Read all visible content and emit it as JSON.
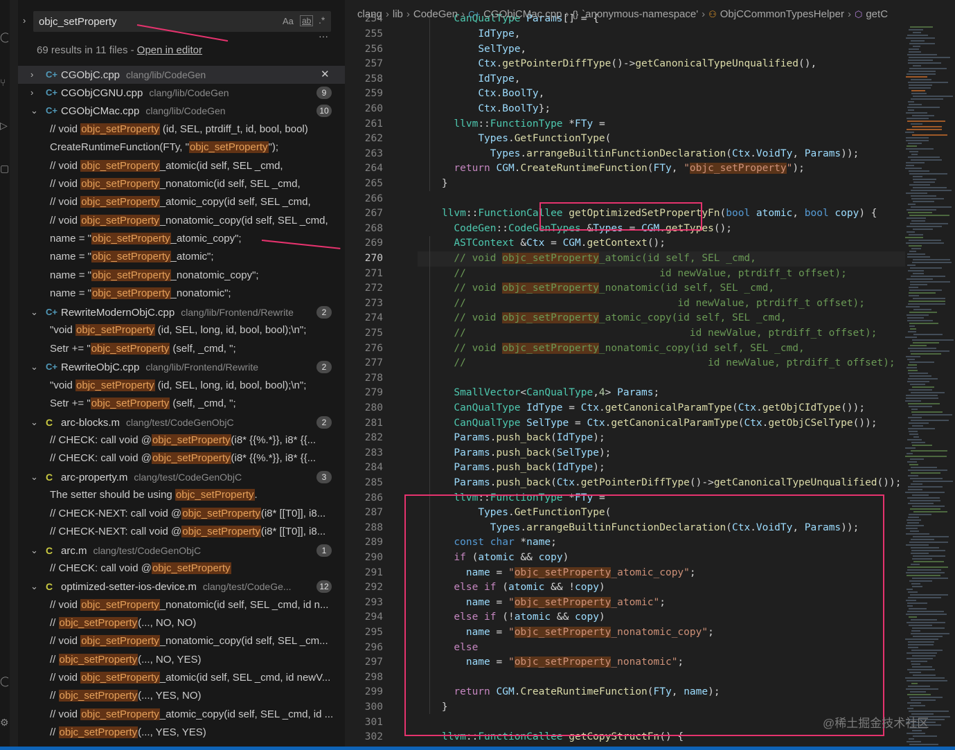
{
  "search": {
    "query": "objc_setProperty",
    "option_case": "Aa",
    "option_word": "ab",
    "option_regex": ".*",
    "more": "···",
    "summary": "69 results in 11 files - ",
    "open_in_editor": "Open in editor"
  },
  "results": [
    {
      "kind": "file",
      "icon": "C+",
      "lang": "cpp",
      "name": "CGObjC.cpp",
      "path": "clang/lib/CodeGen",
      "close": "✕",
      "selected": true,
      "collapsed": true
    },
    {
      "kind": "file",
      "icon": "C+",
      "lang": "cpp",
      "name": "CGObjCGNU.cpp",
      "path": "clang/lib/CodeGen",
      "badge": "9",
      "collapsed": true
    },
    {
      "kind": "file",
      "icon": "C+",
      "lang": "cpp",
      "name": "CGObjCMac.cpp",
      "path": "clang/lib/CodeGen",
      "badge": "10"
    },
    {
      "kind": "match",
      "pre": "// void ",
      "hl": "objc_setProperty",
      "post": " (id, SEL, ptrdiff_t, id, bool, bool)"
    },
    {
      "kind": "match",
      "pre": "CreateRuntimeFunction(FTy, \"",
      "hl": "objc_setProperty",
      "post": "\");"
    },
    {
      "kind": "match",
      "pre": "// void ",
      "hl": "objc_setProperty",
      "post": "_atomic(id self, SEL _cmd,"
    },
    {
      "kind": "match",
      "pre": "// void ",
      "hl": "objc_setProperty",
      "post": "_nonatomic(id self, SEL _cmd,"
    },
    {
      "kind": "match",
      "pre": "// void ",
      "hl": "objc_setProperty",
      "post": "_atomic_copy(id self, SEL _cmd,"
    },
    {
      "kind": "match",
      "pre": "// void ",
      "hl": "objc_setProperty",
      "post": "_nonatomic_copy(id self, SEL _cmd,"
    },
    {
      "kind": "match",
      "pre": "name = \"",
      "hl": "objc_setProperty",
      "post": "_atomic_copy\";"
    },
    {
      "kind": "match",
      "pre": "name = \"",
      "hl": "objc_setProperty",
      "post": "_atomic\";"
    },
    {
      "kind": "match",
      "pre": "name = \"",
      "hl": "objc_setProperty",
      "post": "_nonatomic_copy\";"
    },
    {
      "kind": "match",
      "pre": "name = \"",
      "hl": "objc_setProperty",
      "post": "_nonatomic\";"
    },
    {
      "kind": "file",
      "icon": "C+",
      "lang": "cpp",
      "name": "RewriteModernObjC.cpp",
      "path": "clang/lib/Frontend/Rewrite",
      "badge": "2"
    },
    {
      "kind": "match",
      "pre": "\"void ",
      "hl": "objc_setProperty",
      "post": " (id, SEL, long, id, bool, bool);\\n\";"
    },
    {
      "kind": "match",
      "pre": "Setr += \"",
      "hl": "objc_setProperty",
      "post": " (self, _cmd, \";"
    },
    {
      "kind": "file",
      "icon": "C+",
      "lang": "cpp",
      "name": "RewriteObjC.cpp",
      "path": "clang/lib/Frontend/Rewrite",
      "badge": "2"
    },
    {
      "kind": "match",
      "pre": "\"void ",
      "hl": "objc_setProperty",
      "post": " (id, SEL, long, id, bool, bool);\\n\";"
    },
    {
      "kind": "match",
      "pre": "Setr += \"",
      "hl": "objc_setProperty",
      "post": " (self, _cmd, \";"
    },
    {
      "kind": "file",
      "icon": "C",
      "lang": "c",
      "name": "arc-blocks.m",
      "path": "clang/test/CodeGenObjC",
      "badge": "2"
    },
    {
      "kind": "match",
      "pre": "// CHECK:    call void @",
      "hl": "objc_setProperty",
      "post": "(i8* {{%.*}}, i8* {{..."
    },
    {
      "kind": "match",
      "pre": "// CHECK:    call void @",
      "hl": "objc_setProperty",
      "post": "(i8* {{%.*}}, i8* {{..."
    },
    {
      "kind": "file",
      "icon": "C",
      "lang": "c",
      "name": "arc-property.m",
      "path": "clang/test/CodeGenObjC",
      "badge": "3"
    },
    {
      "kind": "match",
      "pre": "The setter should be using ",
      "hl": "objc_setProperty",
      "post": "."
    },
    {
      "kind": "match",
      "pre": "// CHECK-NEXT: call void @",
      "hl": "objc_setProperty",
      "post": "(i8* [[T0]], i8..."
    },
    {
      "kind": "match",
      "pre": "// CHECK-NEXT: call void @",
      "hl": "objc_setProperty",
      "post": "(i8* [[T0]], i8..."
    },
    {
      "kind": "file",
      "icon": "C",
      "lang": "c",
      "name": "arc.m",
      "path": "clang/test/CodeGenObjC",
      "badge": "1"
    },
    {
      "kind": "match",
      "pre": "// CHECK: call void @",
      "hl": "objc_setProperty",
      "post": ""
    },
    {
      "kind": "file",
      "icon": "C",
      "lang": "c",
      "name": "optimized-setter-ios-device.m",
      "path": "clang/test/CodeGe...",
      "badge": "12"
    },
    {
      "kind": "match",
      "pre": "// void ",
      "hl": "objc_setProperty",
      "post": "_nonatomic(id self, SEL _cmd, id n..."
    },
    {
      "kind": "match",
      "pre": "// ",
      "hl": "objc_setProperty",
      "post": "(..., NO, NO)"
    },
    {
      "kind": "match",
      "pre": "// void ",
      "hl": "objc_setProperty",
      "post": "_nonatomic_copy(id self, SEL _cm..."
    },
    {
      "kind": "match",
      "pre": "// ",
      "hl": "objc_setProperty",
      "post": "(..., NO, YES)"
    },
    {
      "kind": "match",
      "pre": "// void ",
      "hl": "objc_setProperty",
      "post": "_atomic(id self, SEL _cmd, id newV..."
    },
    {
      "kind": "match",
      "pre": "// ",
      "hl": "objc_setProperty",
      "post": "(..., YES, NO)"
    },
    {
      "kind": "match",
      "pre": "// void ",
      "hl": "objc_setProperty",
      "post": "_atomic_copy(id self, SEL _cmd, id ..."
    },
    {
      "kind": "match",
      "pre": "// ",
      "hl": "objc_setProperty",
      "post": "(..., YES, YES)"
    }
  ],
  "breadcrumb": {
    "items": [
      {
        "label": "clang"
      },
      {
        "label": "lib"
      },
      {
        "label": "CodeGen"
      },
      {
        "icon": "C+",
        "label": "CGObjCMac.cpp"
      },
      {
        "icon": "{}",
        "label": "`anonymous-namespace'"
      },
      {
        "icon": "⚇",
        "label": "ObjCCommonTypesHelper"
      },
      {
        "icon": "⬡",
        "label": "getC"
      }
    ]
  },
  "editor": {
    "current_line": "270",
    "lines": [
      {
        "n": "254",
        "t": "      CanQualType Params[] = {"
      },
      {
        "n": "255",
        "t": "          IdType,"
      },
      {
        "n": "256",
        "t": "          SelType,"
      },
      {
        "n": "257",
        "t": "          Ctx.getPointerDiffType()->getCanonicalTypeUnqualified(),"
      },
      {
        "n": "258",
        "t": "          IdType,"
      },
      {
        "n": "259",
        "t": "          Ctx.BoolTy,"
      },
      {
        "n": "260",
        "t": "          Ctx.BoolTy};"
      },
      {
        "n": "261",
        "t": "      llvm::FunctionType *FTy ="
      },
      {
        "n": "262",
        "t": "          Types.GetFunctionType("
      },
      {
        "n": "263",
        "t": "            Types.arrangeBuiltinFunctionDeclaration(Ctx.VoidTy, Params));"
      },
      {
        "n": "264",
        "t": "      return CGM.CreateRuntimeFunction(FTy, \"objc_setProperty\");"
      },
      {
        "n": "265",
        "t": "    }"
      },
      {
        "n": "266",
        "t": ""
      },
      {
        "n": "267",
        "t": "    llvm::FunctionCallee getOptimizedSetPropertyFn(bool atomic, bool copy) {"
      },
      {
        "n": "268",
        "t": "      CodeGen::CodeGenTypes &Types = CGM.getTypes();"
      },
      {
        "n": "269",
        "t": "      ASTContext &Ctx = CGM.getContext();"
      },
      {
        "n": "270",
        "t": "      // void objc_setProperty_atomic(id self, SEL _cmd,"
      },
      {
        "n": "271",
        "t": "      //                                id newValue, ptrdiff_t offset);"
      },
      {
        "n": "272",
        "t": "      // void objc_setProperty_nonatomic(id self, SEL _cmd,"
      },
      {
        "n": "273",
        "t": "      //                                   id newValue, ptrdiff_t offset);"
      },
      {
        "n": "274",
        "t": "      // void objc_setProperty_atomic_copy(id self, SEL _cmd,"
      },
      {
        "n": "275",
        "t": "      //                                     id newValue, ptrdiff_t offset);"
      },
      {
        "n": "276",
        "t": "      // void objc_setProperty_nonatomic_copy(id self, SEL _cmd,"
      },
      {
        "n": "277",
        "t": "      //                                        id newValue, ptrdiff_t offset);"
      },
      {
        "n": "278",
        "t": ""
      },
      {
        "n": "279",
        "t": "      SmallVector<CanQualType,4> Params;"
      },
      {
        "n": "280",
        "t": "      CanQualType IdType = Ctx.getCanonicalParamType(Ctx.getObjCIdType());"
      },
      {
        "n": "281",
        "t": "      CanQualType SelType = Ctx.getCanonicalParamType(Ctx.getObjCSelType());"
      },
      {
        "n": "282",
        "t": "      Params.push_back(IdType);"
      },
      {
        "n": "283",
        "t": "      Params.push_back(SelType);"
      },
      {
        "n": "284",
        "t": "      Params.push_back(IdType);"
      },
      {
        "n": "285",
        "t": "      Params.push_back(Ctx.getPointerDiffType()->getCanonicalTypeUnqualified());"
      },
      {
        "n": "286",
        "t": "      llvm::FunctionType *FTy ="
      },
      {
        "n": "287",
        "t": "          Types.GetFunctionType("
      },
      {
        "n": "288",
        "t": "            Types.arrangeBuiltinFunctionDeclaration(Ctx.VoidTy, Params));"
      },
      {
        "n": "289",
        "t": "      const char *name;"
      },
      {
        "n": "290",
        "t": "      if (atomic && copy)"
      },
      {
        "n": "291",
        "t": "        name = \"objc_setProperty_atomic_copy\";"
      },
      {
        "n": "292",
        "t": "      else if (atomic && !copy)"
      },
      {
        "n": "293",
        "t": "        name = \"objc_setProperty_atomic\";"
      },
      {
        "n": "294",
        "t": "      else if (!atomic && copy)"
      },
      {
        "n": "295",
        "t": "        name = \"objc_setProperty_nonatomic_copy\";"
      },
      {
        "n": "296",
        "t": "      else"
      },
      {
        "n": "297",
        "t": "        name = \"objc_setProperty_nonatomic\";"
      },
      {
        "n": "298",
        "t": ""
      },
      {
        "n": "299",
        "t": "      return CGM.CreateRuntimeFunction(FTy, name);"
      },
      {
        "n": "300",
        "t": "    }"
      },
      {
        "n": "301",
        "t": ""
      },
      {
        "n": "302",
        "t": "    llvm::FunctionCallee getCopyStructFn() {"
      }
    ]
  },
  "watermark": "@稀土掘金技术社区",
  "colors": {
    "annotation": "#e6336e",
    "match_highlight": "#623315",
    "status_bar": "#0e63b7"
  }
}
